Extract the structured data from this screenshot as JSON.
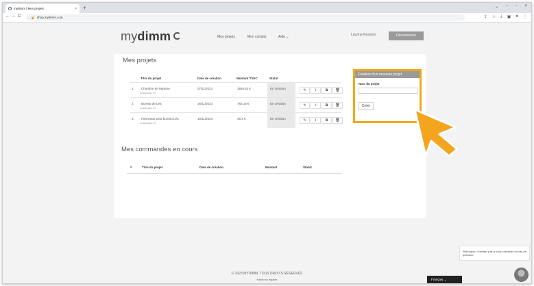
{
  "browser": {
    "tab_title": "mydimm | Mes projets",
    "tab_close": "×",
    "new_tab": "+",
    "url": "shop.mydimm.com",
    "nav": [
      "←",
      "→",
      "C"
    ],
    "window_controls": [
      "⌄",
      "–",
      "▫",
      "×"
    ],
    "toolbar_icons": [
      "⇪",
      "☆",
      "⤓",
      "▣",
      "●",
      "⋮"
    ]
  },
  "header": {
    "logo_light": "my",
    "logo_bold": "dimm",
    "nav": {
      "projects": "Mes projets",
      "account": "Mon compte",
      "help": "Aide ⌄"
    },
    "user": "Laurine Rossion",
    "logout": "Déconnexion"
  },
  "projects": {
    "title": "Mes projets",
    "headers": [
      "Titre du projet",
      "Date de création",
      "Montant TVAC",
      "Statut"
    ],
    "rows": [
      {
        "num": "1.",
        "title": "Chambre de Maxime",
        "sub": "Configurateur 2.0",
        "date": "07/11/2023",
        "amount": "3926.62 €",
        "status": "En création"
      },
      {
        "num": "2.",
        "title": "Bureau de Léa",
        "sub": "Configurateur 2.0",
        "date": "16/11/2023",
        "amount": "782.18 €",
        "status": "En création"
      },
      {
        "num": "3.",
        "title": "Panneaux pour bureau Léa",
        "sub": "Configurateur 2.0",
        "date": "16/11/2023",
        "amount": "48.4 €",
        "status": "En création"
      }
    ],
    "action_icons": [
      "✎",
      "Ⅰ",
      "⧉",
      "🗑"
    ]
  },
  "new_project": {
    "header": "Création d'un nouveau projet",
    "label": "Nom du projet",
    "input_value": "",
    "button": "Créer"
  },
  "orders": {
    "title": "Mes commandes en cours",
    "headers": [
      "#",
      "Titre du projet",
      "Date de création",
      "Montant",
      "Statut"
    ]
  },
  "footer": {
    "copyright": "© 2023 MYDIMM, TOUS DROITS RÉSERVÉS",
    "legal": "Mentions légales"
  },
  "language": "Français ⌄",
  "chat_text": "Rebonjour, n'hésitez pas à nous contacter en cas de question.",
  "colors": {
    "highlight": "#f0a818",
    "cursor": "#f4a51e"
  }
}
